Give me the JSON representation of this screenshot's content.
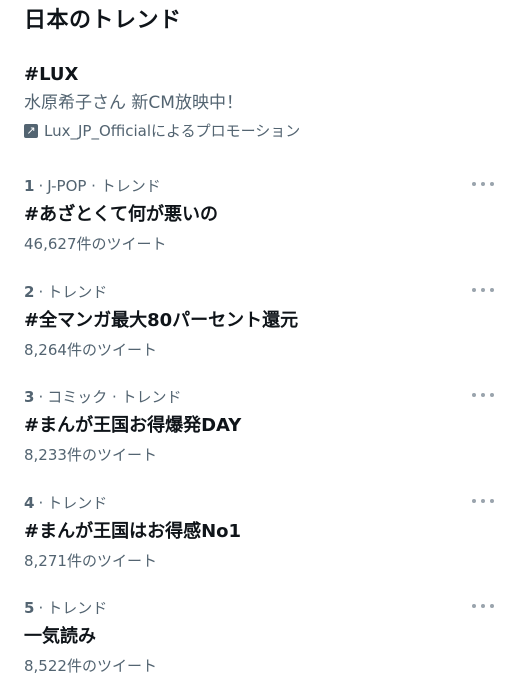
{
  "header": {
    "title": "日本のトレンド"
  },
  "promoted": {
    "hashtag": "#LUX",
    "description": "水原希子さん 新CM放映中！",
    "promoter": "Lux_JP_Officialによるプロモーション",
    "promo_icon": "promoted-arrow-icon"
  },
  "trends": [
    {
      "rank": "1",
      "category": "J-POP · トレンド",
      "name": "#あざとくて何が悪いの",
      "count": "46,627件のツイート"
    },
    {
      "rank": "2",
      "category": "トレンド",
      "name": "#全マンガ最大80パーセント還元",
      "count": "8,264件のツイート"
    },
    {
      "rank": "3",
      "category": "コミック · トレンド",
      "name": "#まんが王国お得爆発DAY",
      "count": "8,233件のツイート"
    },
    {
      "rank": "4",
      "category": "トレンド",
      "name": "#まんが王国はお得感No1",
      "count": "8,271件のツイート"
    },
    {
      "rank": "5",
      "category": "トレンド",
      "name": "一気読み",
      "count": "8,522件のツイート"
    }
  ],
  "separator": "·",
  "icons": {
    "more": "more-options-icon"
  }
}
